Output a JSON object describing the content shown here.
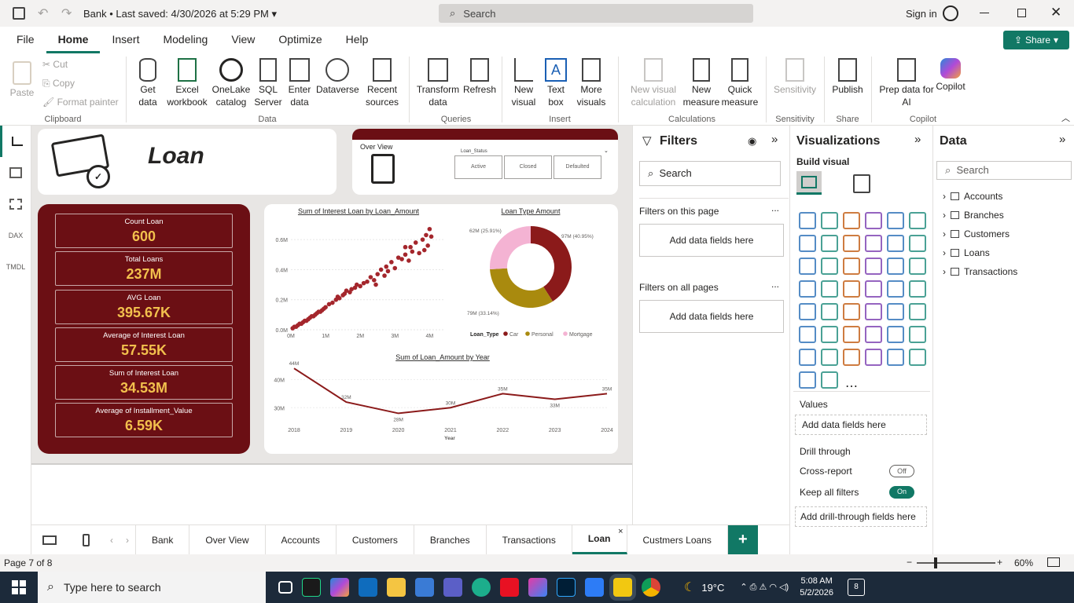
{
  "titlebar": {
    "doc_title": "Bank",
    "saved": "Last saved: 4/30/2026 at 5:29 PM",
    "search_placeholder": "Search",
    "sign_in": "Sign in"
  },
  "menu": {
    "tabs": [
      "File",
      "Home",
      "Insert",
      "Modeling",
      "View",
      "Optimize",
      "Help"
    ],
    "share": "Share"
  },
  "ribbon": {
    "clipboard": {
      "paste": "Paste",
      "cut": "Cut",
      "copy": "Copy",
      "format_painter": "Format painter",
      "group": "Clipboard"
    },
    "data": {
      "get_data": "Get data",
      "excel": "Excel workbook",
      "onelake": "OneLake catalog",
      "sql": "SQL Server",
      "enter": "Enter data",
      "dataverse": "Dataverse",
      "recent": "Recent sources",
      "group": "Data"
    },
    "queries": {
      "transform": "Transform data",
      "refresh": "Refresh",
      "group": "Queries"
    },
    "insert": {
      "new_visual": "New visual",
      "text_box": "Text box",
      "more_visuals": "More visuals",
      "group": "Insert"
    },
    "calculations": {
      "new_calc": "New visual calculation",
      "new_measure": "New measure",
      "quick_measure": "Quick measure",
      "group": "Calculations"
    },
    "sensitivity": {
      "label": "Sensitivity",
      "group": "Sensitivity"
    },
    "share": {
      "publish": "Publish",
      "group": "Share"
    },
    "copilot": {
      "prep": "Prep data for AI",
      "copilot": "Copilot",
      "group": "Copilot"
    }
  },
  "report": {
    "header_title": "Loan",
    "overview_btn": "Over View",
    "slicer_title": "Loan_Status",
    "slicer_options": [
      "Active",
      "Closed",
      "Defaulted"
    ],
    "kpis": [
      {
        "label": "Count Loan",
        "value": "600"
      },
      {
        "label": "Total Loans",
        "value": "237M"
      },
      {
        "label": "AVG Loan",
        "value": "395.67K"
      },
      {
        "label": "Average of Interest Loan",
        "value": "57.55K"
      },
      {
        "label": "Sum of Interest Loan",
        "value": "34.53M"
      },
      {
        "label": "Average of Installment_Value",
        "value": "6.59K"
      }
    ]
  },
  "chart_data": [
    {
      "type": "scatter",
      "title": "Sum of Interest Loan by Loan_Amount",
      "xticks": [
        "0M",
        "1M",
        "2M",
        "3M",
        "4M"
      ],
      "yticks": [
        "0.0M",
        "0.2M",
        "0.4M",
        "0.6M"
      ],
      "xlim": [
        0,
        4.4
      ],
      "ylim": [
        0,
        0.7
      ],
      "points": [
        [
          0.05,
          0.01
        ],
        [
          0.1,
          0.02
        ],
        [
          0.15,
          0.02
        ],
        [
          0.2,
          0.03
        ],
        [
          0.25,
          0.04
        ],
        [
          0.3,
          0.04
        ],
        [
          0.35,
          0.05
        ],
        [
          0.4,
          0.06
        ],
        [
          0.45,
          0.06
        ],
        [
          0.5,
          0.07
        ],
        [
          0.55,
          0.08
        ],
        [
          0.6,
          0.09
        ],
        [
          0.65,
          0.09
        ],
        [
          0.7,
          0.1
        ],
        [
          0.75,
          0.11
        ],
        [
          0.8,
          0.12
        ],
        [
          0.85,
          0.12
        ],
        [
          0.9,
          0.13
        ],
        [
          0.95,
          0.14
        ],
        [
          1.0,
          0.15
        ],
        [
          1.1,
          0.17
        ],
        [
          1.2,
          0.18
        ],
        [
          1.3,
          0.2
        ],
        [
          1.35,
          0.22
        ],
        [
          1.4,
          0.21
        ],
        [
          1.5,
          0.23
        ],
        [
          1.55,
          0.24
        ],
        [
          1.6,
          0.26
        ],
        [
          1.7,
          0.25
        ],
        [
          1.75,
          0.27
        ],
        [
          1.85,
          0.28
        ],
        [
          1.9,
          0.3
        ],
        [
          2.0,
          0.29
        ],
        [
          2.1,
          0.31
        ],
        [
          2.2,
          0.32
        ],
        [
          2.3,
          0.35
        ],
        [
          2.4,
          0.33
        ],
        [
          2.5,
          0.37
        ],
        [
          2.6,
          0.4
        ],
        [
          2.7,
          0.36
        ],
        [
          2.75,
          0.42
        ],
        [
          2.9,
          0.45
        ],
        [
          3.0,
          0.41
        ],
        [
          3.1,
          0.48
        ],
        [
          3.2,
          0.47
        ],
        [
          3.3,
          0.5
        ],
        [
          3.4,
          0.46
        ],
        [
          3.45,
          0.55
        ],
        [
          3.5,
          0.52
        ],
        [
          3.6,
          0.58
        ],
        [
          3.7,
          0.51
        ],
        [
          3.8,
          0.6
        ],
        [
          3.9,
          0.63
        ],
        [
          3.95,
          0.56
        ],
        [
          4.0,
          0.67
        ],
        [
          4.05,
          0.62
        ],
        [
          3.85,
          0.53
        ],
        [
          3.3,
          0.55
        ],
        [
          2.8,
          0.39
        ],
        [
          2.45,
          0.3
        ]
      ]
    },
    {
      "type": "pie",
      "title": "Loan Type Amount",
      "legend_title": "Loan_Type",
      "labels": [
        "Car",
        "Personal",
        "Mortgage"
      ],
      "values": [
        40.95,
        33.14,
        25.91
      ],
      "data_labels": [
        "97M (40.95%)",
        "79M (33.14%)",
        "62M (25.91%)"
      ],
      "colors": [
        "#8b1a1a",
        "#a98a0e",
        "#f4b3d3"
      ]
    },
    {
      "type": "line",
      "title": "Sum of Loan_Amount by Year",
      "xlabel": "Year",
      "x": [
        "2018",
        "2019",
        "2020",
        "2021",
        "2022",
        "2023",
        "2024"
      ],
      "values": [
        44,
        32,
        28,
        30,
        35,
        33,
        35
      ],
      "data_labels": [
        "44M",
        "32M",
        "28M",
        "30M",
        "35M",
        "33M",
        "35M"
      ],
      "yticks": [
        "30M",
        "40M"
      ],
      "ylim": [
        27,
        46
      ]
    }
  ],
  "filters": {
    "title": "Filters",
    "search": "Search",
    "this_page": "Filters on this page",
    "all_pages": "Filters on all pages",
    "add": "Add data fields here",
    "more": "..."
  },
  "viz": {
    "title": "Visualizations",
    "build": "Build visual",
    "values": "Values",
    "add_values": "Add data fields here",
    "drill": "Drill through",
    "cross_report": "Cross-report",
    "cross_state": "Off",
    "keep_filters": "Keep all filters",
    "keep_state": "On",
    "add_drill": "Add drill-through fields here"
  },
  "data_pane": {
    "title": "Data",
    "search": "Search",
    "tables": [
      "Accounts",
      "Branches",
      "Customers",
      "Loans",
      "Transactions"
    ]
  },
  "pages": [
    "Bank",
    "Over View",
    "Accounts",
    "Customers",
    "Branches",
    "Transactions",
    "Loan",
    "Custmers Loans"
  ],
  "status": {
    "page": "Page 7 of 8",
    "zoom": "60%"
  },
  "taskbar": {
    "search": "Type here to search",
    "weather": "19°C",
    "time": "5:08 AM",
    "date": "5/2/2026",
    "notif": "8"
  },
  "colors": {
    "accent": "#117865",
    "maroon": "#6b0f14",
    "gold": "#f2c04d"
  }
}
